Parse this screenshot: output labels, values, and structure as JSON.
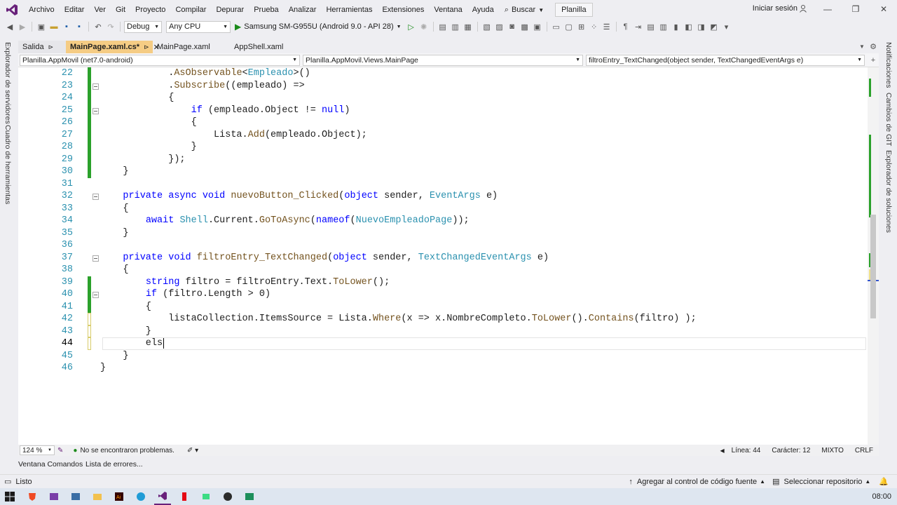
{
  "menu": {
    "items": [
      "Archivo",
      "Editar",
      "Ver",
      "Git",
      "Proyecto",
      "Compilar",
      "Depurar",
      "Prueba",
      "Analizar",
      "Herramientas",
      "Extensiones",
      "Ventana",
      "Ayuda"
    ],
    "search_label": "Buscar",
    "solution_name": "Planilla",
    "signin": "Iniciar sesión"
  },
  "toolbar": {
    "config": "Debug",
    "platform": "Any CPU",
    "run_target": "Samsung SM-G955U (Android 9.0 - API 28)"
  },
  "side_left": {
    "tab1": "Explorador de servidores",
    "tab2": "Cuadro de herramientas"
  },
  "side_right": {
    "tab1": "Notificaciones",
    "tab2": "Cambios de GIT",
    "tab3": "Explorador de soluciones"
  },
  "tabs": [
    {
      "label": "Salida",
      "pin": "⊳"
    },
    {
      "label": "MainPage.xaml.cs*",
      "pin": "⊳"
    },
    {
      "label": "MainPage.xaml",
      "pin": ""
    },
    {
      "label": "AppShell.xaml",
      "pin": ""
    }
  ],
  "navbar": {
    "project": "Planilla.AppMovil (net7.0-android)",
    "class": "Planilla.AppMovil.Views.MainPage",
    "member": "filtroEntry_TextChanged(object sender, TextChangedEventArgs e)"
  },
  "code_lines": [
    {
      "n": "22",
      "code": [
        [
          "tx",
          "            ."
        ],
        [
          "fn",
          "AsObservable"
        ],
        [
          "tx",
          "<"
        ],
        [
          "ty",
          "Empleado"
        ],
        [
          "tx",
          ">()"
        ]
      ]
    },
    {
      "n": "23",
      "code": [
        [
          "tx",
          "            ."
        ],
        [
          "fn",
          "Subscribe"
        ],
        [
          "tx",
          "((empleado) =>"
        ]
      ]
    },
    {
      "n": "24",
      "code": [
        [
          "tx",
          "            {"
        ]
      ]
    },
    {
      "n": "25",
      "code": [
        [
          "tx",
          "                "
        ],
        [
          "kw",
          "if"
        ],
        [
          "tx",
          " (empleado.Object != "
        ],
        [
          "kw",
          "null"
        ],
        [
          "tx",
          ")"
        ]
      ]
    },
    {
      "n": "26",
      "code": [
        [
          "tx",
          "                {"
        ]
      ]
    },
    {
      "n": "27",
      "code": [
        [
          "tx",
          "                    Lista."
        ],
        [
          "fn",
          "Add"
        ],
        [
          "tx",
          "(empleado.Object);"
        ]
      ]
    },
    {
      "n": "28",
      "code": [
        [
          "tx",
          "                }"
        ]
      ]
    },
    {
      "n": "29",
      "code": [
        [
          "tx",
          "            });"
        ]
      ]
    },
    {
      "n": "30",
      "code": [
        [
          "tx",
          "    }"
        ]
      ]
    },
    {
      "n": "31",
      "code": [
        [
          "tx",
          ""
        ]
      ]
    },
    {
      "n": "32",
      "code": [
        [
          "tx",
          "    "
        ],
        [
          "kw",
          "private async void"
        ],
        [
          "tx",
          " "
        ],
        [
          "fn",
          "nuevoButton_Clicked"
        ],
        [
          "tx",
          "("
        ],
        [
          "kw",
          "object"
        ],
        [
          "tx",
          " sender, "
        ],
        [
          "ty",
          "EventArgs"
        ],
        [
          "tx",
          " e)"
        ]
      ]
    },
    {
      "n": "33",
      "code": [
        [
          "tx",
          "    {"
        ]
      ]
    },
    {
      "n": "34",
      "code": [
        [
          "tx",
          "        "
        ],
        [
          "kw",
          "await"
        ],
        [
          "tx",
          " "
        ],
        [
          "ty",
          "Shell"
        ],
        [
          "tx",
          ".Current."
        ],
        [
          "fn",
          "GoToAsync"
        ],
        [
          "tx",
          "("
        ],
        [
          "kw",
          "nameof"
        ],
        [
          "tx",
          "("
        ],
        [
          "ty",
          "NuevoEmpleadoPage"
        ],
        [
          "tx",
          "));"
        ]
      ]
    },
    {
      "n": "35",
      "code": [
        [
          "tx",
          "    }"
        ]
      ]
    },
    {
      "n": "36",
      "code": [
        [
          "tx",
          ""
        ]
      ]
    },
    {
      "n": "37",
      "code": [
        [
          "tx",
          "    "
        ],
        [
          "kw",
          "private void"
        ],
        [
          "tx",
          " "
        ],
        [
          "fn",
          "filtroEntry_TextChanged"
        ],
        [
          "tx",
          "("
        ],
        [
          "kw",
          "object"
        ],
        [
          "tx",
          " sender, "
        ],
        [
          "ty",
          "TextChangedEventArgs"
        ],
        [
          "tx",
          " e)"
        ]
      ]
    },
    {
      "n": "38",
      "code": [
        [
          "tx",
          "    {"
        ]
      ]
    },
    {
      "n": "39",
      "code": [
        [
          "tx",
          "        "
        ],
        [
          "kw",
          "string"
        ],
        [
          "tx",
          " filtro = filtroEntry.Text."
        ],
        [
          "fn",
          "ToLower"
        ],
        [
          "tx",
          "();"
        ]
      ]
    },
    {
      "n": "40",
      "code": [
        [
          "tx",
          "        "
        ],
        [
          "kw",
          "if"
        ],
        [
          "tx",
          " (filtro.Length > 0)"
        ]
      ]
    },
    {
      "n": "41",
      "code": [
        [
          "tx",
          "        {"
        ]
      ]
    },
    {
      "n": "42",
      "code": [
        [
          "tx",
          "            listaCollection.ItemsSource = Lista."
        ],
        [
          "fn",
          "Where"
        ],
        [
          "tx",
          "(x => x.NombreCompleto."
        ],
        [
          "fn",
          "ToLower"
        ],
        [
          "tx",
          "()."
        ],
        [
          "fn",
          "Contains"
        ],
        [
          "tx",
          "(filtro) );"
        ]
      ]
    },
    {
      "n": "43",
      "code": [
        [
          "tx",
          "        }"
        ]
      ]
    },
    {
      "n": "44",
      "code": [
        [
          "tx",
          "        els"
        ]
      ]
    },
    {
      "n": "45",
      "code": [
        [
          "tx",
          "    }"
        ]
      ]
    },
    {
      "n": "46",
      "code": [
        [
          "tx",
          "}"
        ]
      ]
    }
  ],
  "status_mini": {
    "zoom": "124 %",
    "issues": "No se encontraron problemas.",
    "line": "Línea: 44",
    "char": "Carácter: 12",
    "mode": "MIXTO",
    "eol": "CRLF"
  },
  "bottom_tabs": [
    "Ventana Comandos",
    "Lista de errores..."
  ],
  "status": {
    "ready": "Listo",
    "source_control": "Agregar al control de código fuente",
    "repo": "Seleccionar repositorio"
  },
  "taskbar": {
    "time": "08:00"
  },
  "colors": {
    "accent": "#68217a",
    "change_green": "#2ba12b",
    "change_yellow": "#efe08a",
    "active_tab": "#f5cc84"
  }
}
